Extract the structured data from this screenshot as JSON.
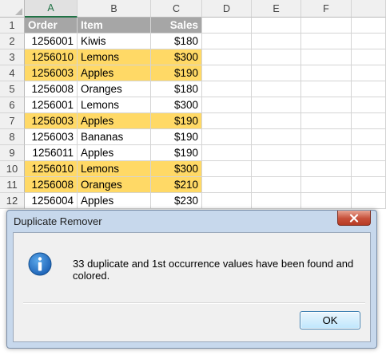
{
  "sheet": {
    "columns": [
      "A",
      "B",
      "C",
      "D",
      "E",
      "F"
    ],
    "selected_column": "A",
    "rows": [
      {
        "num": "1",
        "a": "Order",
        "b": "Item",
        "c": "Sales",
        "header": true,
        "highlight": false
      },
      {
        "num": "2",
        "a": "1256001",
        "b": "Kiwis",
        "c": "$180",
        "header": false,
        "highlight": false
      },
      {
        "num": "3",
        "a": "1256010",
        "b": "Lemons",
        "c": "$300",
        "header": false,
        "highlight": true
      },
      {
        "num": "4",
        "a": "1256003",
        "b": "Apples",
        "c": "$190",
        "header": false,
        "highlight": true
      },
      {
        "num": "5",
        "a": "1256008",
        "b": "Oranges",
        "c": "$180",
        "header": false,
        "highlight": false
      },
      {
        "num": "6",
        "a": "1256001",
        "b": "Lemons",
        "c": "$300",
        "header": false,
        "highlight": false
      },
      {
        "num": "7",
        "a": "1256003",
        "b": "Apples",
        "c": "$190",
        "header": false,
        "highlight": true
      },
      {
        "num": "8",
        "a": "1256003",
        "b": "Bananas",
        "c": "$190",
        "header": false,
        "highlight": false
      },
      {
        "num": "9",
        "a": "1256011",
        "b": "Apples",
        "c": "$190",
        "header": false,
        "highlight": false
      },
      {
        "num": "10",
        "a": "1256010",
        "b": "Lemons",
        "c": "$300",
        "header": false,
        "highlight": true
      },
      {
        "num": "11",
        "a": "1256008",
        "b": "Oranges",
        "c": "$210",
        "header": false,
        "highlight": true
      },
      {
        "num": "12",
        "a": "1256004",
        "b": "Apples",
        "c": "$230",
        "header": false,
        "highlight": false
      }
    ],
    "colors": {
      "header_bg": "#a6a6a6",
      "highlight_bg": "#ffd966"
    }
  },
  "dialog": {
    "title": "Duplicate Remover",
    "message": "33 duplicate and 1st occurrence values have been found and colored.",
    "ok_label": "OK",
    "icon": "info-icon",
    "close_icon": "close-icon"
  }
}
